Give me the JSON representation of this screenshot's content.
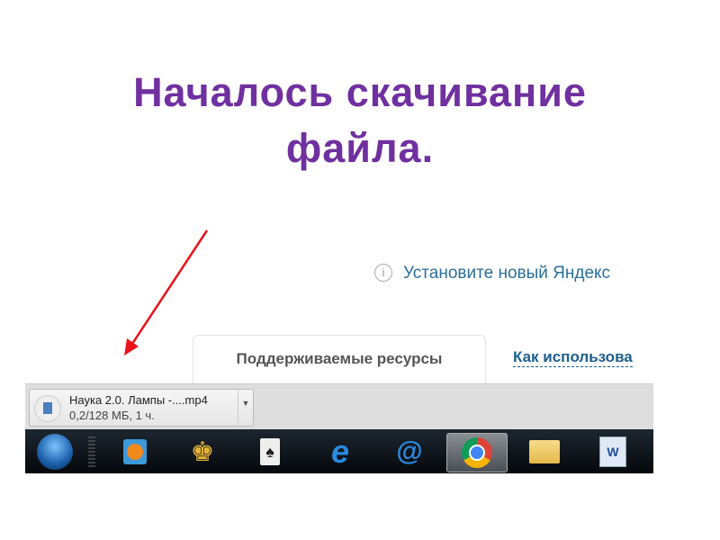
{
  "slide": {
    "title_line1": "Началось скачивание",
    "title_line2": "файла."
  },
  "browser": {
    "notice": "Установите новый Яндекс",
    "tab_label": "Поддерживаемые ресурсы",
    "link_label": "Как использова",
    "download": {
      "filename": "Наука 2.0. Лампы -....mp4",
      "status": "0,2/128 МБ, 1 ч."
    }
  },
  "taskbar": {
    "items": [
      "start",
      "media-player",
      "king-game",
      "solitaire",
      "internet-explorer",
      "mail-agent",
      "chrome",
      "file-explorer",
      "word"
    ],
    "active": "chrome"
  },
  "colors": {
    "title": "#7030a0",
    "arrow": "#e8141b"
  }
}
